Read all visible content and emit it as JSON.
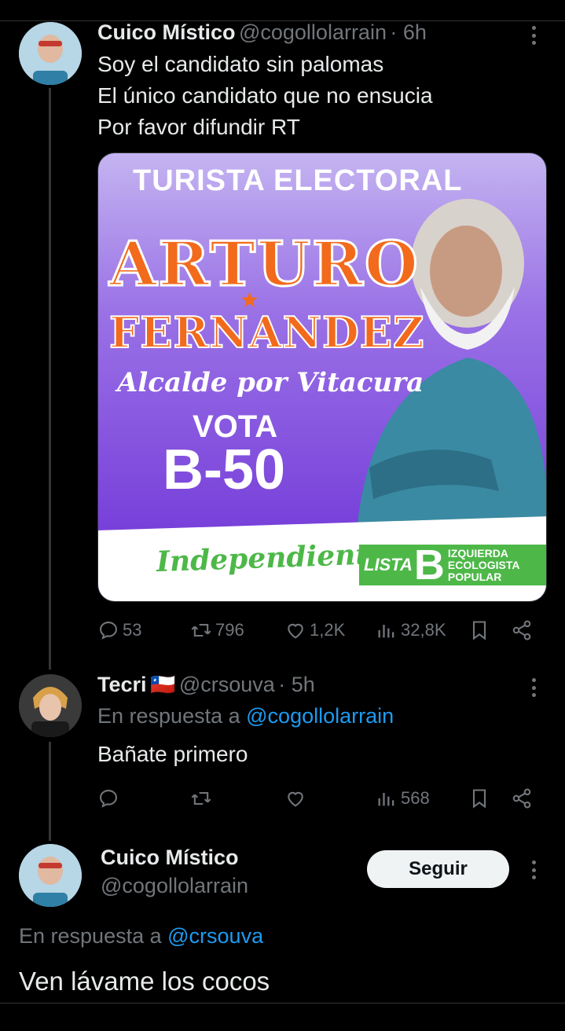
{
  "tweet1": {
    "name": "Cuico Místico",
    "handle": "@cogollolarrain",
    "time": "· 6h",
    "lines": [
      "Soy el candidato sin palomas",
      "El único candidato que no ensucia",
      "Por favor difundir RT"
    ],
    "image": {
      "header": "TURISTA ELECTORAL",
      "first_name": "ARTURO",
      "last_name": "FERNANDEZ",
      "subtitle": "Alcalde por Vitacura",
      "vota": "VOTA",
      "number": "B-50",
      "independiente": "Independiente",
      "lista": "LISTA",
      "lista_letter": "B",
      "party_lines": [
        "IZQUIERDA",
        "ECOLOGISTA",
        "POPULAR"
      ],
      "colors": {
        "purple": "#7d46db",
        "orange": "#f26a1b",
        "green": "#4db848"
      }
    },
    "stats": {
      "replies": "53",
      "retweets": "796",
      "likes": "1,2K",
      "views": "32,8K"
    }
  },
  "tweet2": {
    "name": "Tecri",
    "flag": "🇨🇱",
    "handle": "@crsouva",
    "time": "· 5h",
    "reply_prefix": "En respuesta a",
    "reply_to": "@cogollolarrain",
    "text": "Bañate primero",
    "stats": {
      "replies": "",
      "retweets": "",
      "likes": "",
      "views": "568"
    }
  },
  "tweet3": {
    "name": "Cuico Místico",
    "handle": "@cogollolarrain",
    "follow_label": "Seguir",
    "reply_prefix": "En respuesta a",
    "reply_to": "@crsouva",
    "text": "Ven lávame los cocos"
  }
}
